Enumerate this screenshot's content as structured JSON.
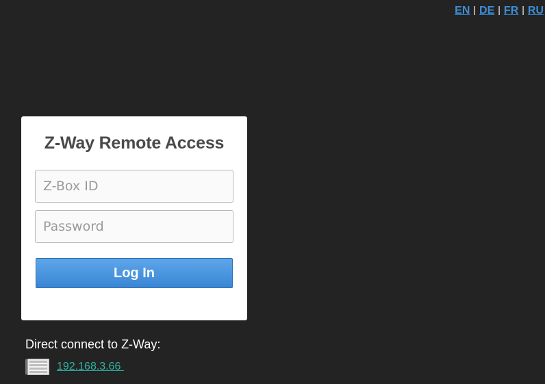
{
  "languages": [
    {
      "code": "EN"
    },
    {
      "code": "DE"
    },
    {
      "code": "FR"
    },
    {
      "code": "RU"
    }
  ],
  "language_separator": "|",
  "login": {
    "title": "Z-Way Remote Access",
    "zbox_id_placeholder": "Z-Box ID",
    "password_placeholder": "Password",
    "button_label": "Log In"
  },
  "direct": {
    "label": "Direct connect to Z-Way:",
    "servers": [
      {
        "address": "192.168.3.66 ",
        "icon": "server-icon"
      }
    ]
  },
  "colors": {
    "background": "#232323",
    "link_blue": "#3d8fd9",
    "button_blue": "#4a96df",
    "server_link": "#2fb5a5"
  }
}
